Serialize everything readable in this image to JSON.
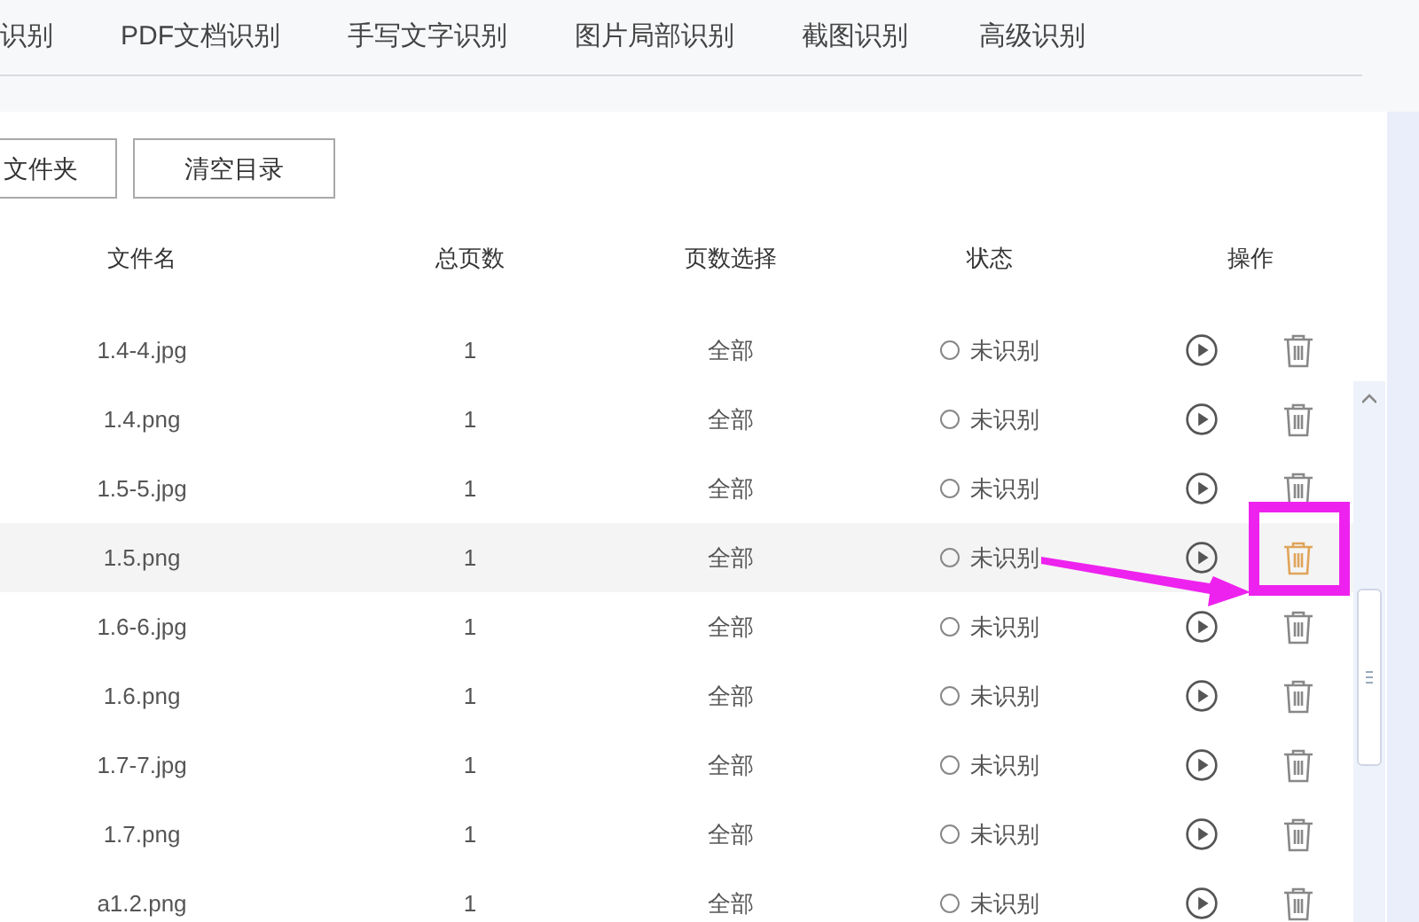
{
  "tabs": [
    {
      "label": "识别",
      "selected": false
    },
    {
      "label": "PDF文档识别",
      "selected": false
    },
    {
      "label": "手写文字识别",
      "selected": false
    },
    {
      "label": "图片局部识别",
      "selected": false
    },
    {
      "label": "截图识别",
      "selected": false
    },
    {
      "label": "高级识别",
      "selected": false
    }
  ],
  "buttons": [
    "文件夹",
    "清空目录"
  ],
  "table": {
    "columns": [
      "文件名",
      "总页数",
      "页数选择",
      "状态",
      "操作"
    ],
    "rows": [
      {
        "name": "1.4-4.jpg",
        "pages": "1",
        "range": "全部",
        "status": "未识别",
        "highlighted": false
      },
      {
        "name": "1.4.png",
        "pages": "1",
        "range": "全部",
        "status": "未识别",
        "highlighted": false
      },
      {
        "name": "1.5-5.jpg",
        "pages": "1",
        "range": "全部",
        "status": "未识别",
        "highlighted": false
      },
      {
        "name": "1.5.png",
        "pages": "1",
        "range": "全部",
        "status": "未识别",
        "highlighted": true
      },
      {
        "name": "1.6-6.jpg",
        "pages": "1",
        "range": "全部",
        "status": "未识别",
        "highlighted": false
      },
      {
        "name": "1.6.png",
        "pages": "1",
        "range": "全部",
        "status": "未识别",
        "highlighted": false
      },
      {
        "name": "1.7-7.jpg",
        "pages": "1",
        "range": "全部",
        "status": "未识别",
        "highlighted": false
      },
      {
        "name": "1.7.png",
        "pages": "1",
        "range": "全部",
        "status": "未识别",
        "highlighted": false
      },
      {
        "name": "a1.2.png",
        "pages": "1",
        "range": "全部",
        "status": "未识别",
        "highlighted": false
      }
    ]
  }
}
